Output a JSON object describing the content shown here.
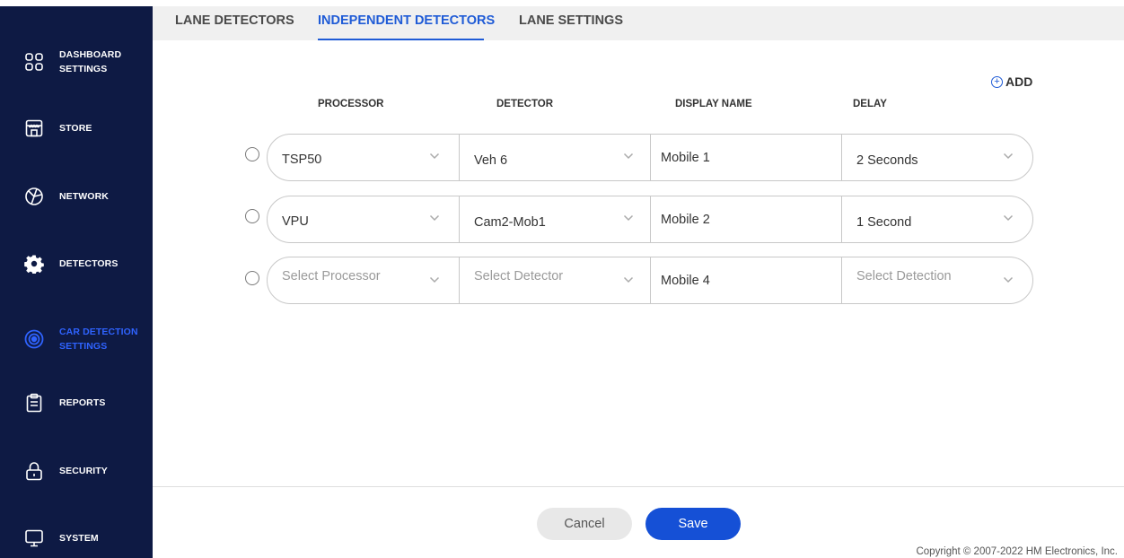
{
  "sidebar": {
    "items": [
      {
        "line1": "DASHBOARD",
        "line2": "SETTINGS",
        "icon": "dashboard-grid-icon"
      },
      {
        "line1": "STORE",
        "line2": "",
        "icon": "store-icon"
      },
      {
        "line1": "NETWORK",
        "line2": "",
        "icon": "network-icon"
      },
      {
        "line1": "DETECTORS",
        "line2": "",
        "icon": "gear-icon"
      },
      {
        "line1": "CAR DETECTION",
        "line2": "SETTINGS",
        "icon": "car-detection-icon",
        "active": true
      },
      {
        "line1": "REPORTS",
        "line2": "",
        "icon": "clipboard-icon"
      },
      {
        "line1": "SECURITY",
        "line2": "",
        "icon": "lock-icon"
      },
      {
        "line1": "SYSTEM",
        "line2": "",
        "icon": "monitor-icon"
      }
    ]
  },
  "tabs": [
    {
      "label": "LANE DETECTORS"
    },
    {
      "label": "INDEPENDENT DETECTORS",
      "active": true
    },
    {
      "label": "LANE SETTINGS"
    }
  ],
  "add_label": "ADD",
  "columns": {
    "processor": "PROCESSOR",
    "detector": "DETECTOR",
    "display_name": "DISPLAY NAME",
    "delay": "DELAY"
  },
  "rows": [
    {
      "processor": "TSP50",
      "detector": "Veh 6",
      "display_name": "Mobile 1",
      "delay": "2 Seconds",
      "placeholder": false
    },
    {
      "processor": "VPU",
      "detector": "Cam2-Mob1",
      "display_name": "Mobile 2",
      "delay": "1 Second",
      "placeholder": false
    },
    {
      "processor": "Select Processor",
      "detector": "Select Detector",
      "display_name": "Mobile 4",
      "delay": "Select Detection",
      "placeholder": true
    }
  ],
  "buttons": {
    "cancel": "Cancel",
    "save": "Save"
  },
  "copyright": "Copyright © 2007-2022 HM Electronics, Inc.",
  "colors": {
    "sidebar_bg": "#0e1a44",
    "accent": "#1f5bd6",
    "active_nav": "#2f63ff",
    "save_bg": "#1550d6"
  }
}
